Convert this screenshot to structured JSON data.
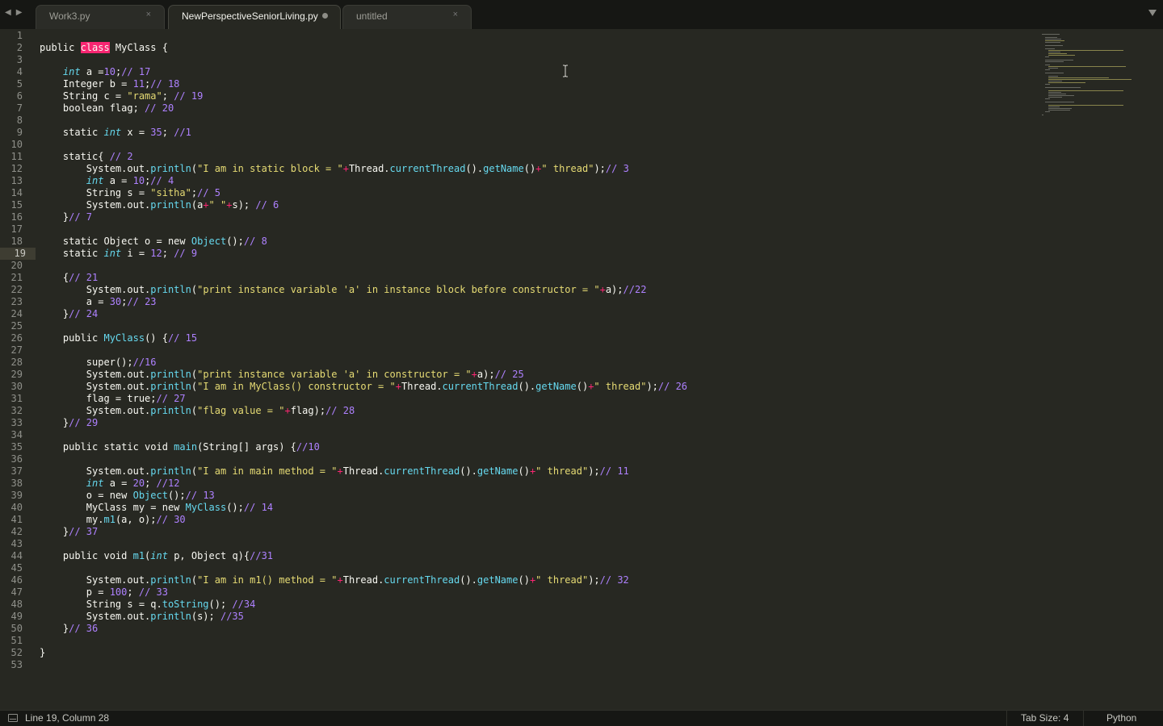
{
  "tabs": [
    {
      "label": "Work3.py",
      "state": "inactive",
      "marker": "close"
    },
    {
      "label": "NewPerspectiveSeniorLiving.py",
      "state": "active",
      "marker": "unsaved"
    },
    {
      "label": "untitled",
      "state": "inactive",
      "marker": "close"
    }
  ],
  "tab_close_glyph": "×",
  "nav": {
    "back_glyph": "◀",
    "forward_glyph": "▶"
  },
  "editor": {
    "current_line": 19,
    "lines": [
      "",
      "public class MyClass {",
      "",
      "    int a =10;// 17",
      "    Integer b = 11;// 18",
      "    String c = \"rama\"; // 19",
      "    boolean flag; // 20",
      "",
      "    static int x = 35; //1",
      "",
      "    static{ // 2",
      "        System.out.println(\"I am in static block = \"+Thread.currentThread().getName()+\" thread\");// 3",
      "        int a = 10;// 4",
      "        String s = \"sitha\";// 5",
      "        System.out.println(a+\" \"+s); // 6",
      "    }// 7",
      "",
      "    static Object o = new Object();// 8",
      "    static int i = 12; // 9",
      "",
      "    {// 21",
      "        System.out.println(\"print instance variable 'a' in instance block before constructor = \"+a);//22",
      "        a = 30;// 23",
      "    }// 24",
      "",
      "    public MyClass() {// 15",
      "",
      "        super();//16",
      "        System.out.println(\"print instance variable 'a' in constructor = \"+a);// 25",
      "        System.out.println(\"I am in MyClass() constructor = \"+Thread.currentThread().getName()+\" thread\");// 26",
      "        flag = true;// 27",
      "        System.out.println(\"flag value = \"+flag);// 28",
      "    }// 29",
      "",
      "    public static void main(String[] args) {//10",
      "",
      "        System.out.println(\"I am in main method = \"+Thread.currentThread().getName()+\" thread\");// 11",
      "        int a = 20; //12",
      "        o = new Object();// 13",
      "        MyClass my = new MyClass();// 14",
      "        my.m1(a, o);// 30",
      "    }// 37",
      "",
      "    public void m1(int p, Object q){//31",
      "",
      "        System.out.println(\"I am in m1() method = \"+Thread.currentThread().getName()+\" thread\");// 32",
      "        p = 100; // 33",
      "        String s = q.toString(); //34",
      "        System.out.println(s); //35",
      "    }// 36",
      "",
      "}",
      ""
    ]
  },
  "status": {
    "position": "Line 19, Column 28",
    "tab_size": "Tab Size: 4",
    "syntax": "Python"
  },
  "theme": {
    "background": "#272822",
    "keyword_highlight": "#f92672",
    "type": "#66d9ef",
    "number": "#ae81ff",
    "string": "#e6db74",
    "comment": "#ae81ff"
  }
}
